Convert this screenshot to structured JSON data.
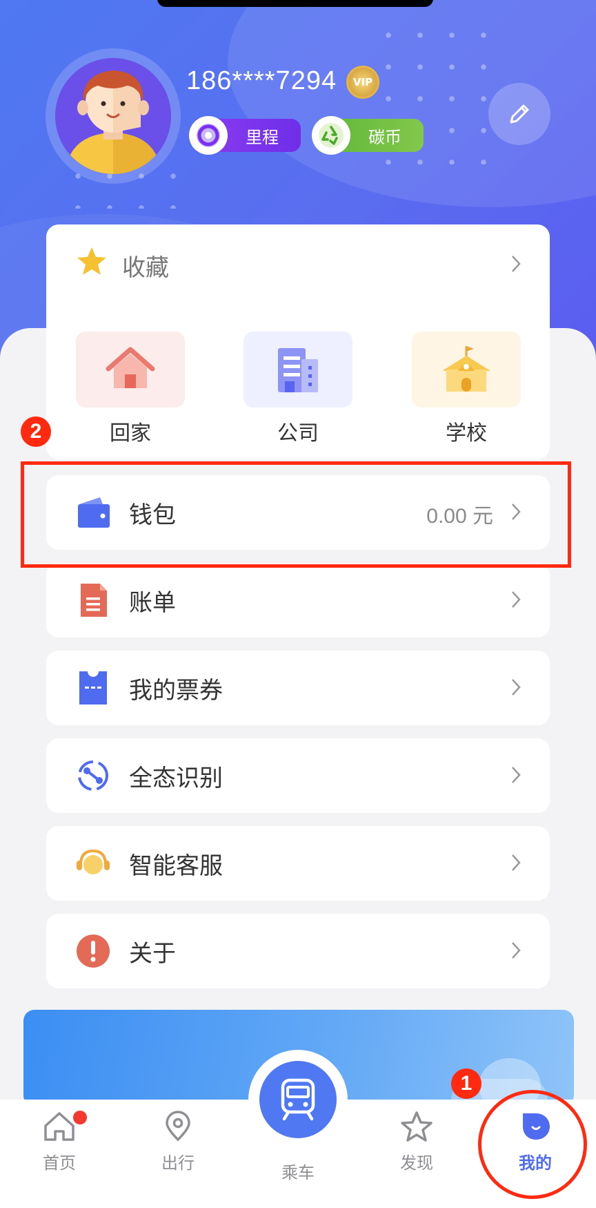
{
  "profile": {
    "phone": "186****7294",
    "vip_badge": "VIP",
    "pills": [
      {
        "label": "里程",
        "color": "#7d33ee",
        "icon": "mileage-ring-icon"
      },
      {
        "label": "碳币",
        "color": "#6dbd3b",
        "icon": "recycle-icon"
      }
    ],
    "edit_icon": "pencil-icon"
  },
  "favorites": {
    "title": "收藏",
    "places": [
      {
        "label": "回家",
        "icon": "home-icon",
        "bg": "#fdecec"
      },
      {
        "label": "公司",
        "icon": "office-building-icon",
        "bg": "#eef0ff"
      },
      {
        "label": "学校",
        "icon": "school-icon",
        "bg": "#fff5e4"
      }
    ]
  },
  "menu": [
    {
      "label": "钱包",
      "value": "0.00 元",
      "icon": "wallet-icon"
    },
    {
      "label": "账单",
      "value": "",
      "icon": "bill-icon"
    },
    {
      "label": "我的票券",
      "value": "",
      "icon": "ticket-icon"
    },
    {
      "label": "全态识别",
      "value": "",
      "icon": "recognition-icon"
    },
    {
      "label": "智能客服",
      "value": "",
      "icon": "headset-icon"
    },
    {
      "label": "关于",
      "value": "",
      "icon": "info-icon"
    }
  ],
  "tabs": [
    {
      "label": "首页",
      "icon": "home-tab-icon",
      "active": false,
      "badge": true
    },
    {
      "label": "出行",
      "icon": "location-pin-icon",
      "active": false
    },
    {
      "label": "乘车",
      "icon": "train-icon",
      "active": false
    },
    {
      "label": "发现",
      "icon": "star-tab-icon",
      "active": false
    },
    {
      "label": "我的",
      "icon": "profile-tab-icon",
      "active": true
    }
  ],
  "annotations": {
    "step1": "1",
    "step2": "2"
  },
  "colors": {
    "primary": "#4f78f2",
    "annotation": "#ff2a10",
    "active_tab": "#4f6cf0"
  }
}
